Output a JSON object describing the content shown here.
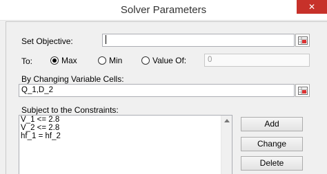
{
  "window": {
    "title": "Solver Parameters",
    "close_glyph": "✕"
  },
  "objective": {
    "label": "Set Objective:",
    "value": ""
  },
  "to": {
    "label": "To:",
    "options": [
      {
        "label": "Max",
        "selected": true
      },
      {
        "label": "Min",
        "selected": false
      },
      {
        "label": "Value Of:",
        "selected": false
      }
    ],
    "value_of": "0"
  },
  "variables": {
    "label": "By Changing Variable Cells:",
    "value": "Q_1,D_2"
  },
  "constraints": {
    "label": "Subject to the Constraints:",
    "items": [
      "V_1 <= 2.8",
      "V_2 <= 2.8",
      "hf_1 = hf_2"
    ]
  },
  "buttons": {
    "add": "Add",
    "change": "Change",
    "delete": "Delete"
  },
  "icons": {
    "ref": "range-select-icon",
    "scroll": "scroll-up-arrow-icon"
  }
}
